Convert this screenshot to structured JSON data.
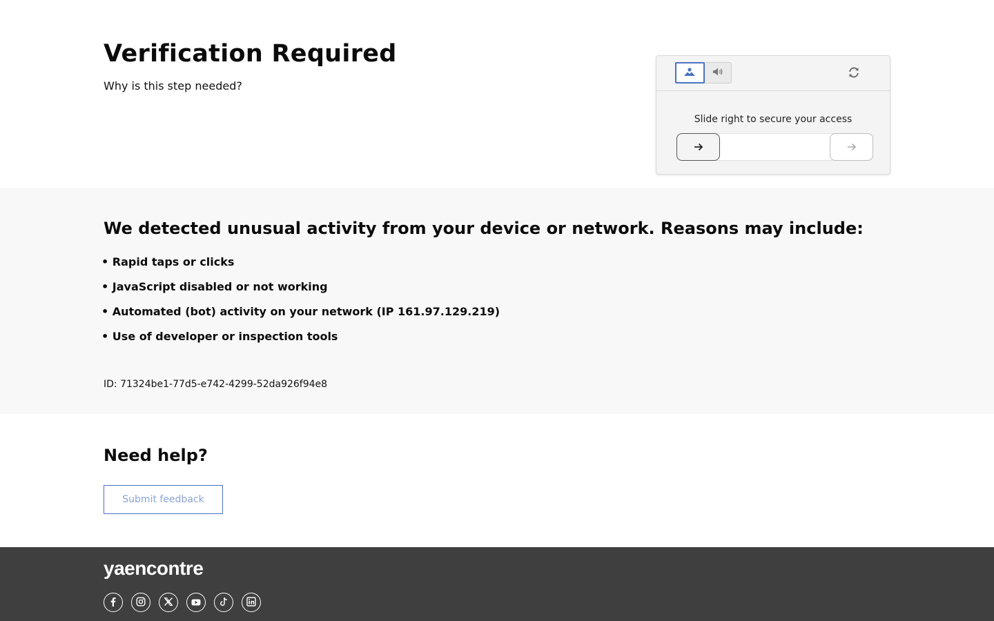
{
  "header": {
    "title": "Verification Required",
    "subtitle_link": "Why is this step needed?"
  },
  "captcha": {
    "modes": [
      {
        "name": "image-mode",
        "icon": "image-icon",
        "active": true
      },
      {
        "name": "audio-mode",
        "icon": "speaker-icon",
        "active": false
      }
    ],
    "refresh_icon": "refresh-icon",
    "instruction": "Slide right to secure your access",
    "slider_progress": 0,
    "accent_color": "#4a72c4"
  },
  "reasons": {
    "heading": "We detected unusual activity from your device or network. Reasons may include:",
    "items": [
      "• Rapid taps or clicks",
      "• JavaScript disabled or not working",
      "• Automated (bot) activity on your network (IP 161.97.129.219)",
      "• Use of developer or inspection tools"
    ],
    "id_text": "ID: 71324be1-77d5-e742-4299-52da926f94e8"
  },
  "help": {
    "heading": "Need help?",
    "button_label": "Submit feedback"
  },
  "footer": {
    "logo": "yaencontre",
    "socials": [
      "facebook-icon",
      "instagram-icon",
      "x-icon",
      "youtube-icon",
      "tiktok-icon",
      "linkedin-icon"
    ]
  }
}
